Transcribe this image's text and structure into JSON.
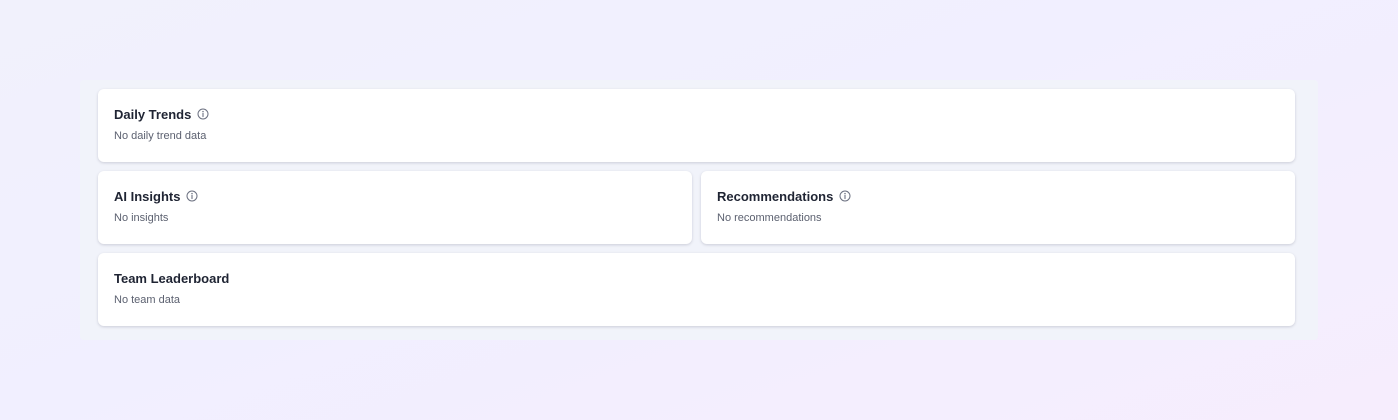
{
  "cards": {
    "daily_trends": {
      "title": "Daily Trends",
      "info_icon": "info-circle-icon",
      "empty_text": "No daily trend data"
    },
    "ai_insights": {
      "title": "AI Insights",
      "info_icon": "info-circle-icon",
      "empty_text": "No insights"
    },
    "recommendations": {
      "title": "Recommendations",
      "info_icon": "info-circle-icon",
      "empty_text": "No recommendations"
    },
    "team_leaderboard": {
      "title": "Team Leaderboard",
      "empty_text": "No team data"
    }
  },
  "colors": {
    "title": "#1f2433",
    "body_text": "#5c6170",
    "icon": "#6b7080",
    "card_bg": "#ffffff",
    "panel_bg": "#f1f3fa"
  }
}
